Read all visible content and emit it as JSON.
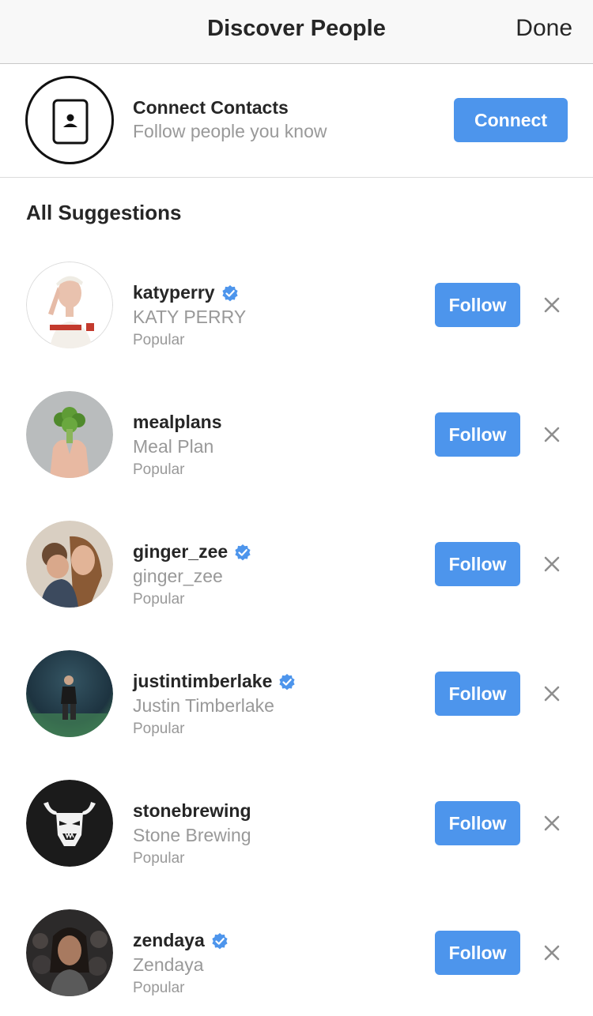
{
  "header": {
    "title": "Discover People",
    "done_label": "Done"
  },
  "contacts": {
    "title": "Connect Contacts",
    "subtitle": "Follow people you know",
    "button_label": "Connect",
    "icon": "contact-card-icon"
  },
  "section_title": "All Suggestions",
  "suggestions": [
    {
      "username": "katyperry",
      "full_name": "KATY PERRY",
      "meta": "Popular",
      "verified": true,
      "follow_label": "Follow",
      "avatar_icon": "profile-photo-katyperry"
    },
    {
      "username": "mealplans",
      "full_name": "Meal Plan",
      "meta": "Popular",
      "verified": false,
      "follow_label": "Follow",
      "avatar_icon": "profile-photo-mealplans"
    },
    {
      "username": "ginger_zee",
      "full_name": "ginger_zee",
      "meta": "Popular",
      "verified": true,
      "follow_label": "Follow",
      "avatar_icon": "profile-photo-ginger-zee"
    },
    {
      "username": "justintimberlake",
      "full_name": "Justin Timberlake",
      "meta": "Popular",
      "verified": true,
      "follow_label": "Follow",
      "avatar_icon": "profile-photo-justintimberlake"
    },
    {
      "username": "stonebrewing",
      "full_name": "Stone Brewing",
      "meta": "Popular",
      "verified": false,
      "follow_label": "Follow",
      "avatar_icon": "profile-photo-stonebrewing"
    },
    {
      "username": "zendaya",
      "full_name": "Zendaya",
      "meta": "Popular",
      "verified": true,
      "follow_label": "Follow",
      "avatar_icon": "profile-photo-zendaya"
    }
  ],
  "colors": {
    "accent": "#4d95ec",
    "secondary_text": "#999999",
    "primary_text": "#262626"
  }
}
